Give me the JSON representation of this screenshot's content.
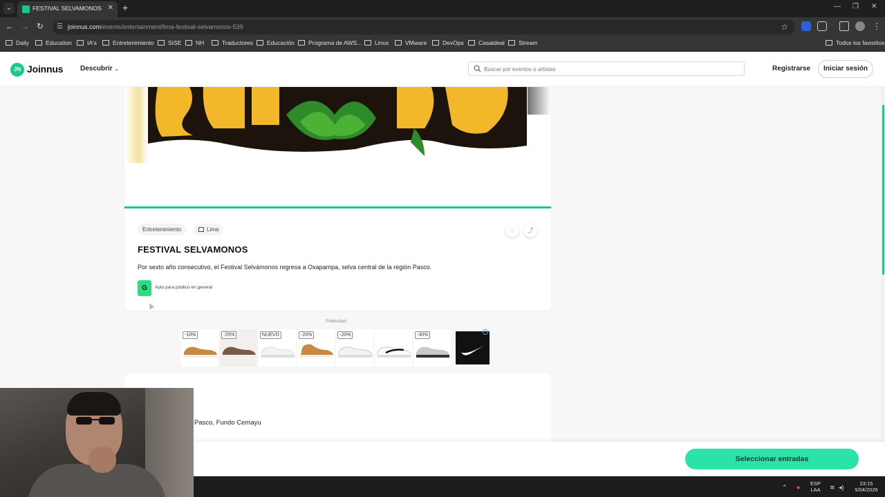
{
  "browser": {
    "tab_title": "FESTIVAL SELVAMONOS | Joinn",
    "url_host": "joinnus.com",
    "url_path": "/events/entertainment/lima-festival-selvamonos-539",
    "bookmarks": [
      "Daily",
      "Education",
      "IA's",
      "Entretenimiento",
      "SISE",
      "NH",
      "Traductores",
      "Educación",
      "Programa de AWS...",
      "Linux",
      "VMware",
      "DevOps",
      "Casaideal",
      "Stream"
    ],
    "all_bookmarks": "Todos los favoritos"
  },
  "header": {
    "logo_text": "Joinnus",
    "logo_mark": "JN",
    "discover": "Descubrir",
    "search_placeholder": "Buscar por eventos o artistas",
    "register": "Registrarse",
    "login": "Iniciar sesión"
  },
  "event": {
    "category": "Entretenimiento",
    "city": "Lima",
    "title": "FESTIVAL SELVAMONOS",
    "description": "Por sexto año consecutivo, el Festival Selvámonos regresa a Oxapampa, selva central de la región Pasco.",
    "rating": "G",
    "rating_text": "Apto para público en general",
    "location_partial": "Pasco, Fundo Cemayu"
  },
  "ad": {
    "label": "Publicidad",
    "tags": [
      "-10%",
      "-25%",
      "NUEVO",
      "-20%",
      "-20%",
      "",
      "-30%"
    ]
  },
  "cta": {
    "select_tickets": "Seleccionar entradas"
  },
  "taskbar": {
    "lang_top": "ESP",
    "lang_bottom": "LAA",
    "time": "23:15",
    "date": "5/04/2026"
  },
  "colors": {
    "brand": "#18c98e",
    "cta": "#2be2a9",
    "rating": "#2ddc7e"
  }
}
